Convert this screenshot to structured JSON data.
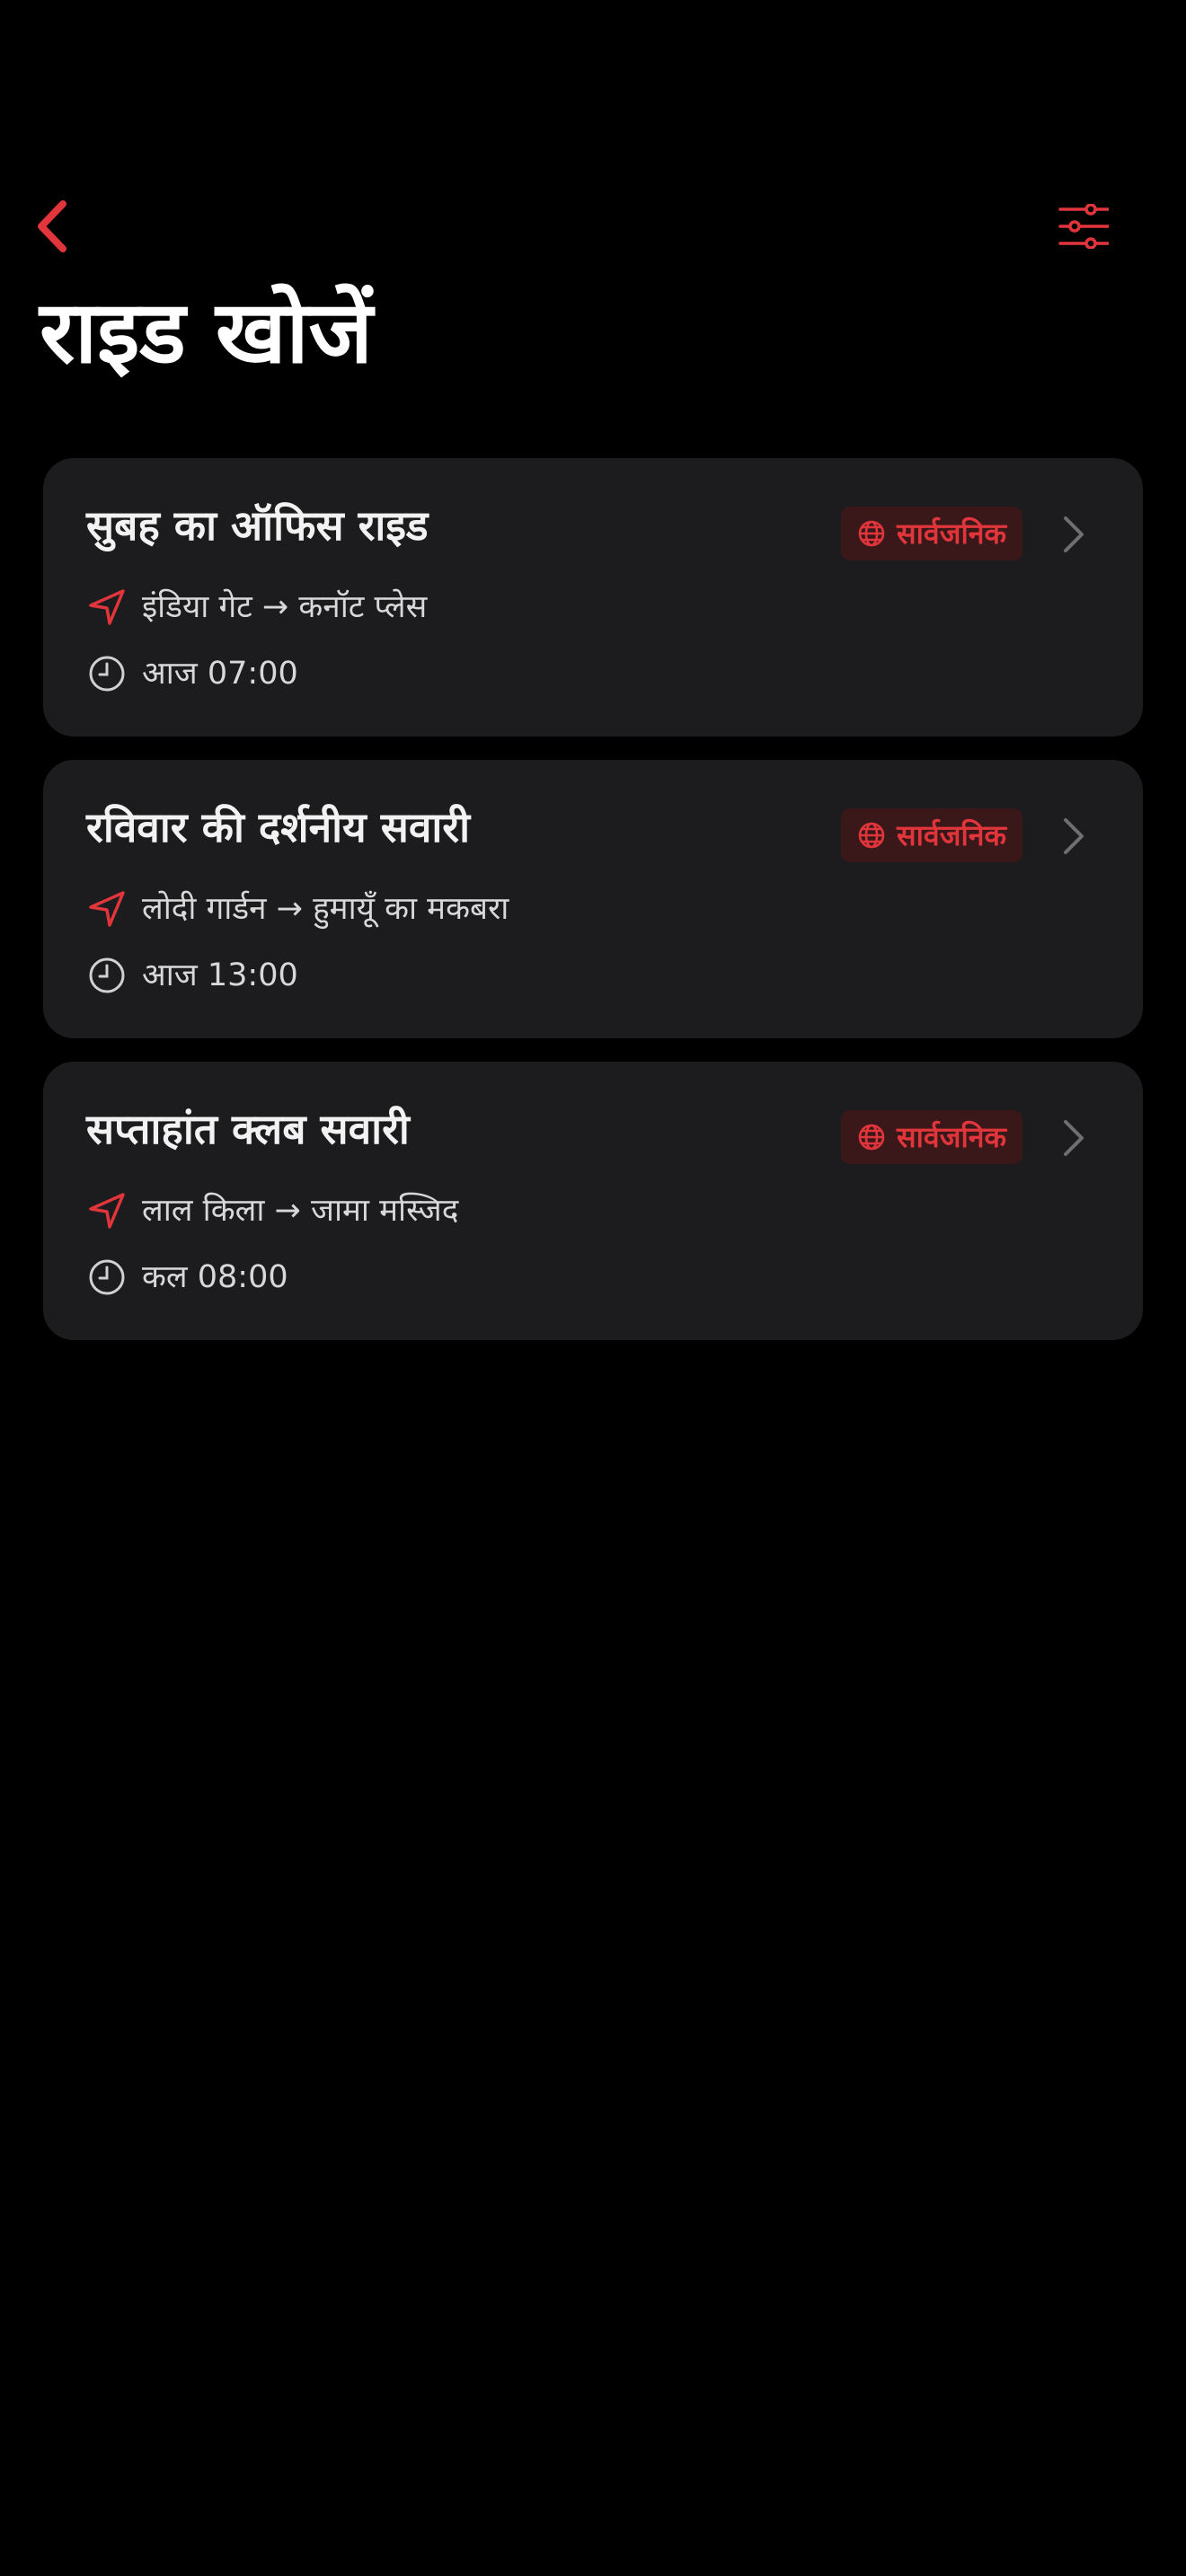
{
  "header": {
    "title": "राइड खोजें",
    "back_icon": "chevron-left-icon",
    "filter_icon": "sliders-icon"
  },
  "colors": {
    "accent": "#e0353b",
    "card_bg": "#1c1c1e",
    "badge_bg": "#3a1719",
    "background": "#000000"
  },
  "rides": [
    {
      "title": "सुबह का ऑफिस राइड",
      "badge": "सार्वजनिक",
      "route": "इंडिया गेट → कनॉट प्लेस",
      "time": "आज 07:00"
    },
    {
      "title": "रविवार की दर्शनीय सवारी",
      "badge": "सार्वजनिक",
      "route": "लोदी गार्डन → हुमायूँ का मकबरा",
      "time": "आज 13:00"
    },
    {
      "title": "सप्ताहांत क्लब सवारी",
      "badge": "सार्वजनिक",
      "route": "लाल किला → जामा मस्जिद",
      "time": "कल 08:00"
    }
  ]
}
